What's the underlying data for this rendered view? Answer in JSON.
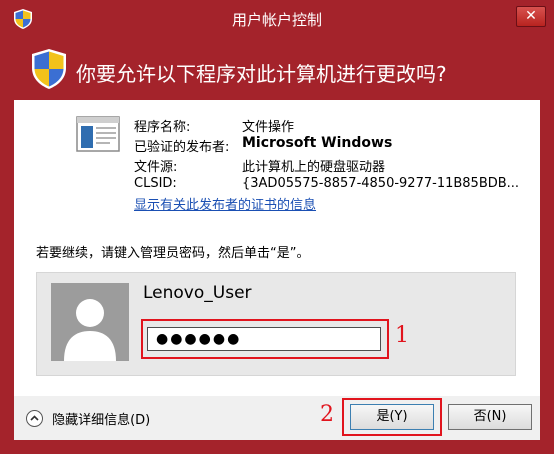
{
  "window": {
    "title": "用户帐户控制",
    "close_label": "✕",
    "frame_color": "#a4232b"
  },
  "header": {
    "question": "你要允许以下程序对此计算机进行更改吗?",
    "icon": "uac-shield-icon"
  },
  "program_info": {
    "icon": "program-window-icon",
    "rows": [
      {
        "label": "程序名称:",
        "value": "文件操作"
      },
      {
        "label": "已验证的发布者:",
        "value": "Microsoft Windows"
      },
      {
        "label": "文件源:",
        "value": "此计算机上的硬盘驱动器"
      },
      {
        "label": "CLSID:",
        "value": "{3AD05575-8857-4850-9277-11B85BDB..."
      }
    ],
    "cert_link": "显示有关此发布者的证书的信息"
  },
  "credentials": {
    "instruction": "若要继续，请键入管理员密码，然后单击“是”。",
    "username": "Lenovo_User",
    "password_mask": "●●●●●●",
    "avatar_icon": "user-avatar-icon",
    "marker_1": "1"
  },
  "footer": {
    "details_toggle": "隐藏详细信息(D)",
    "yes_label": "是(Y)",
    "no_label": "否(N)",
    "marker_2": "2",
    "highlight_color": "#e1141d"
  }
}
